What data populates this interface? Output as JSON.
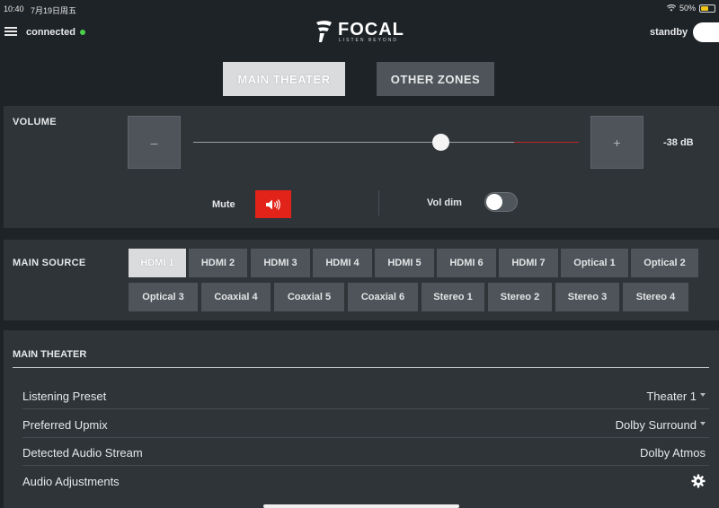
{
  "statusbar": {
    "time": "10:40",
    "date": "7月19日周五",
    "battery": "50%"
  },
  "header": {
    "connection_label": "connected",
    "logo_word": "FOCAL",
    "logo_tagline": "LISTEN BEYOND",
    "standby_label": "standby"
  },
  "tabs": {
    "main": "MAIN THEATER",
    "other": "OTHER ZONES"
  },
  "volume": {
    "label": "VOLUME",
    "minus": "–",
    "plus": "+",
    "value": "-38 dB",
    "mute_label": "Mute",
    "vol_dim_label": "Vol dim"
  },
  "source": {
    "label": "MAIN SOURCE",
    "row1": [
      "HDMI 1",
      "HDMI 2",
      "HDMI 3",
      "HDMI 4",
      "HDMI 5",
      "HDMI 6",
      "HDMI 7",
      "Optical 1",
      "Optical 2"
    ],
    "row2": [
      "Optical 3",
      "Coaxial 4",
      "Coaxial 5",
      "Coaxial 6",
      "Stereo 1",
      "Stereo 2",
      "Stereo 3",
      "Stereo 4"
    ],
    "selected": "HDMI 1"
  },
  "theater": {
    "title": "MAIN THEATER",
    "rows": [
      {
        "label": "Listening Preset",
        "value": "Theater 1"
      },
      {
        "label": "Preferred Upmix",
        "value": "Dolby Surround"
      },
      {
        "label": "Detected Audio Stream",
        "value": "Dolby Atmos"
      },
      {
        "label": "Audio Adjustments",
        "value": ""
      }
    ]
  },
  "colors": {
    "accent_red": "#e2231a",
    "connected_green": "#4cd04c",
    "panel": "#2f3438",
    "background": "#1e2327"
  }
}
